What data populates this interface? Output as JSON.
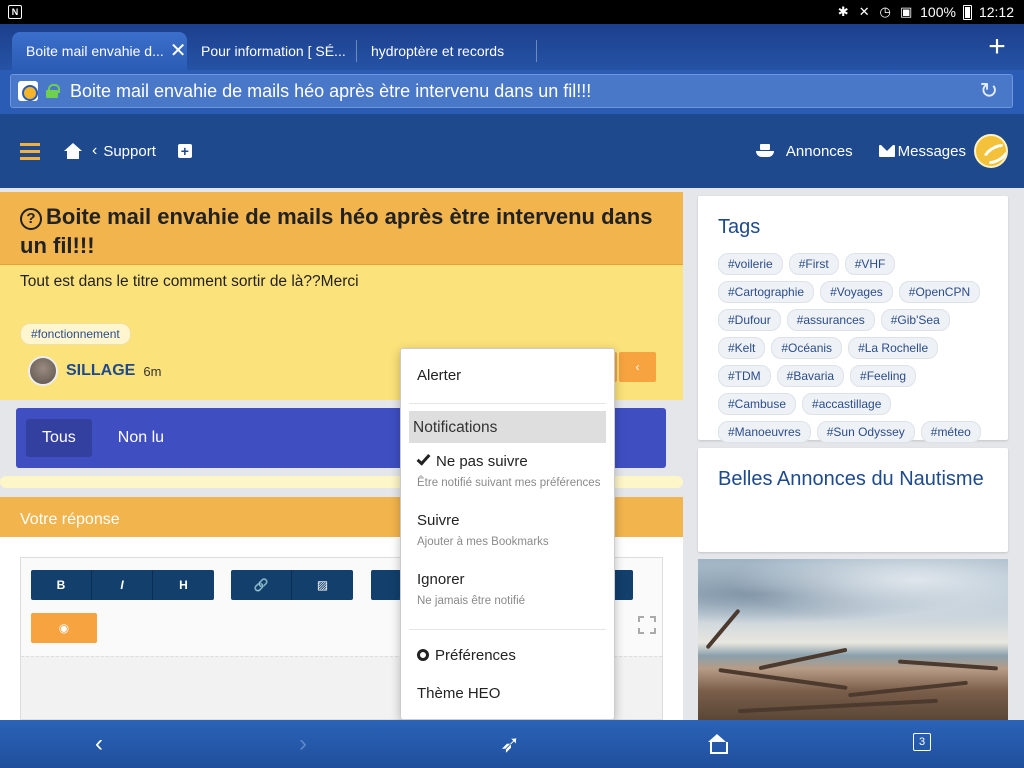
{
  "status": {
    "battery": "100%",
    "time": "12:12"
  },
  "browser": {
    "tabs": [
      {
        "label": "Boite mail envahie d..."
      },
      {
        "label": "Pour information [ SÉ..."
      },
      {
        "label": "hydroptère et records"
      }
    ],
    "url_text": "Boite mail envahie de mails héo après ètre intervenu dans un fil!!!"
  },
  "header": {
    "breadcrumb": "Support",
    "annonces": "Annonces",
    "messages": "Messages"
  },
  "topic": {
    "title": "Boite mail envahie de mails héo après ètre intervenu dans un fil!!!",
    "body": "Tout est dans le titre comment sortir de là??Merci",
    "tag": "#fonctionnement",
    "author": "SILLAGE",
    "time": "6m"
  },
  "filters": {
    "all": "Tous",
    "unread": "Non lu"
  },
  "reply": {
    "heading": "Votre réponse",
    "toolbar": [
      "B",
      "I",
      "H"
    ]
  },
  "dropdown": {
    "alert": "Alerter",
    "notifications": "Notifications",
    "options": [
      {
        "label": "Ne pas suivre",
        "desc": "Être notifié suivant mes préférences",
        "checked": true
      },
      {
        "label": "Suivre",
        "desc": "Ajouter à mes Bookmarks",
        "checked": false
      },
      {
        "label": "Ignorer",
        "desc": "Ne jamais être notifié",
        "checked": false
      }
    ],
    "preferences": "Préférences",
    "theme": "Thème HEO"
  },
  "sidebar": {
    "tags_title": "Tags",
    "tags": [
      "#voilerie",
      "#First",
      "#VHF",
      "#Cartographie",
      "#Voyages",
      "#OpenCPN",
      "#Dufour",
      "#assurances",
      "#Gib'Sea",
      "#Kelt",
      "#Océanis",
      "#La Rochelle",
      "#TDM",
      "#Bavaria",
      "#Feeling",
      "#Cambuse",
      "#accastillage",
      "#Manoeuvres",
      "#Sun Odyssey",
      "#méteo"
    ],
    "annonces_title": "Belles Annonces du Nautisme"
  },
  "bottomnav": {
    "tab_count": "3"
  }
}
